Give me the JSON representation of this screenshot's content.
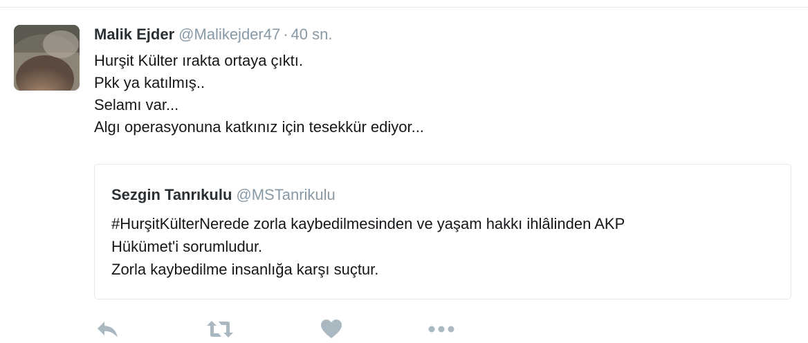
{
  "tweet": {
    "author_name": "Malik Ejder",
    "author_handle": "@Malikejder47",
    "separator": "·",
    "time": "40 sn.",
    "lines": [
      "Hurşit Külter ırakta ortaya çıktı.",
      "Pkk ya katılmış..",
      "Selamı var...",
      "Algı operasyonuna katkınız için tesekkür ediyor..."
    ]
  },
  "quoted_tweet": {
    "author_name": "Sezgin Tanrıkulu",
    "author_handle": "@MSTanrikulu",
    "lines": [
      "#HurşitKülterNerede zorla kaybedilmesinden ve yaşam hakkı ihlâlinden AKP",
      "Hükümet'i sorumludur.",
      "Zorla kaybedilme insanlığa karşı suçtur."
    ]
  },
  "actions": [
    {
      "icon": "reply-icon"
    },
    {
      "icon": "retweet-icon"
    },
    {
      "icon": "like-icon"
    },
    {
      "icon": "more-icon"
    }
  ],
  "colors": {
    "text": "#14171a",
    "muted": "#8899a6",
    "border": "#e1e8ed",
    "action_icon": "#aab8c2"
  }
}
